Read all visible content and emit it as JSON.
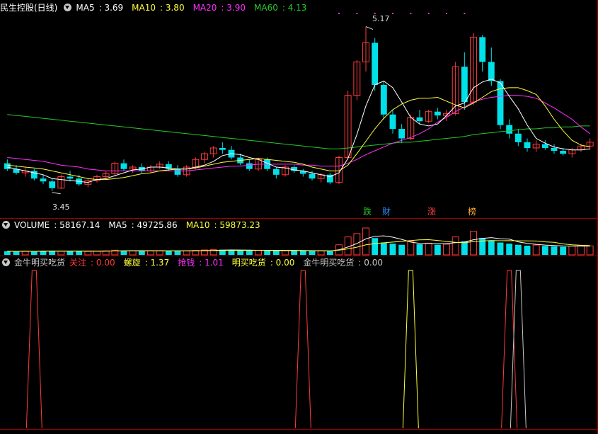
{
  "title": "民生控股(日线)",
  "colors": {
    "up": "#ff3b3b",
    "down": "#00e0e8",
    "ma5": "#ffffff",
    "ma10": "#ffff3c",
    "ma20": "#ff30ff",
    "ma60": "#27c927",
    "border": "#a00000"
  },
  "price_panel": {
    "labels": [
      {
        "name": "MA5",
        "value": "3.69",
        "color": "#ffffff"
      },
      {
        "name": "MA10",
        "value": "3.80",
        "color": "#ffff3c"
      },
      {
        "name": "MA20",
        "value": "3.90",
        "color": "#ff30ff"
      },
      {
        "name": "MA60",
        "value": "4.13",
        "color": "#27c927"
      }
    ],
    "high_mark": "5.17",
    "low_mark": "3.45",
    "signals": [
      {
        "text": "跌",
        "color": "#27c927"
      },
      {
        "text": "财",
        "color": "#2a8cff"
      },
      {
        "text": "涨",
        "color": "#ff4040"
      },
      {
        "text": "榜",
        "color": "#ffaa33"
      }
    ]
  },
  "volume_panel": {
    "title": "VOLUME",
    "value": "58167.14",
    "labels": [
      {
        "name": "MA5",
        "value": "49725.86",
        "color": "#ffffff"
      },
      {
        "name": "MA10",
        "value": "59873.23",
        "color": "#ffff3c"
      }
    ]
  },
  "indicator_panel": {
    "title": "金牛明买吃货",
    "labels": [
      {
        "name": "关注",
        "value": "0.00",
        "color": "#ff3b3b"
      },
      {
        "name": "螺旋",
        "value": "1.37",
        "color": "#ffff3c"
      },
      {
        "name": "抢钱",
        "value": "1.01",
        "color": "#ff30ff"
      },
      {
        "name": "明买吃货",
        "value": "0.00",
        "color": "#ffff3c"
      },
      {
        "name": "金牛明买吃货",
        "value": "0.00",
        "color": "#c8c8c8"
      }
    ]
  },
  "chart_data": {
    "type": "candlestick",
    "price_range": [
      3.3,
      5.3
    ],
    "ohlc": [
      [
        3.74,
        3.78,
        3.66,
        3.68
      ],
      [
        3.68,
        3.72,
        3.62,
        3.64
      ],
      [
        3.64,
        3.7,
        3.6,
        3.66
      ],
      [
        3.66,
        3.68,
        3.56,
        3.58
      ],
      [
        3.58,
        3.62,
        3.52,
        3.55
      ],
      [
        3.55,
        3.58,
        3.45,
        3.48
      ],
      [
        3.48,
        3.62,
        3.47,
        3.6
      ],
      [
        3.6,
        3.66,
        3.55,
        3.58
      ],
      [
        3.58,
        3.62,
        3.5,
        3.52
      ],
      [
        3.52,
        3.58,
        3.49,
        3.56
      ],
      [
        3.56,
        3.62,
        3.54,
        3.6
      ],
      [
        3.6,
        3.66,
        3.57,
        3.63
      ],
      [
        3.63,
        3.76,
        3.6,
        3.74
      ],
      [
        3.74,
        3.78,
        3.66,
        3.68
      ],
      [
        3.68,
        3.72,
        3.64,
        3.7
      ],
      [
        3.7,
        3.74,
        3.64,
        3.66
      ],
      [
        3.66,
        3.72,
        3.64,
        3.7
      ],
      [
        3.7,
        3.76,
        3.68,
        3.73
      ],
      [
        3.73,
        3.76,
        3.66,
        3.68
      ],
      [
        3.68,
        3.72,
        3.6,
        3.62
      ],
      [
        3.62,
        3.72,
        3.6,
        3.7
      ],
      [
        3.7,
        3.8,
        3.68,
        3.78
      ],
      [
        3.78,
        3.86,
        3.74,
        3.84
      ],
      [
        3.84,
        3.92,
        3.8,
        3.9
      ],
      [
        3.9,
        3.96,
        3.84,
        3.88
      ],
      [
        3.88,
        3.92,
        3.78,
        3.8
      ],
      [
        3.8,
        3.84,
        3.72,
        3.74
      ],
      [
        3.74,
        3.78,
        3.66,
        3.68
      ],
      [
        3.68,
        3.8,
        3.66,
        3.78
      ],
      [
        3.78,
        3.8,
        3.66,
        3.68
      ],
      [
        3.68,
        3.7,
        3.58,
        3.62
      ],
      [
        3.62,
        3.72,
        3.6,
        3.7
      ],
      [
        3.7,
        3.72,
        3.64,
        3.66
      ],
      [
        3.66,
        3.68,
        3.6,
        3.63
      ],
      [
        3.63,
        3.66,
        3.56,
        3.58
      ],
      [
        3.58,
        3.64,
        3.54,
        3.62
      ],
      [
        3.62,
        3.64,
        3.52,
        3.54
      ],
      [
        3.54,
        3.82,
        3.52,
        3.8
      ],
      [
        3.8,
        4.5,
        3.78,
        4.45
      ],
      [
        4.45,
        4.82,
        4.4,
        4.8
      ],
      [
        4.8,
        5.17,
        4.7,
        5.0
      ],
      [
        5.0,
        5.05,
        4.5,
        4.56
      ],
      [
        4.56,
        4.6,
        4.2,
        4.25
      ],
      [
        4.25,
        4.3,
        4.05,
        4.1
      ],
      [
        4.1,
        4.15,
        3.95,
        4.0
      ],
      [
        4.0,
        4.25,
        3.98,
        4.22
      ],
      [
        4.22,
        4.3,
        4.15,
        4.18
      ],
      [
        4.18,
        4.3,
        4.16,
        4.28
      ],
      [
        4.28,
        4.32,
        4.2,
        4.24
      ],
      [
        4.24,
        4.3,
        4.18,
        4.26
      ],
      [
        4.26,
        4.8,
        4.24,
        4.75
      ],
      [
        4.75,
        4.9,
        4.3,
        4.38
      ],
      [
        4.38,
        5.1,
        4.35,
        5.06
      ],
      [
        5.06,
        5.08,
        4.7,
        4.8
      ],
      [
        4.8,
        4.95,
        4.55,
        4.6
      ],
      [
        4.6,
        4.62,
        4.1,
        4.14
      ],
      [
        4.14,
        4.2,
        4.0,
        4.05
      ],
      [
        4.05,
        4.1,
        3.92,
        3.96
      ],
      [
        3.96,
        4.0,
        3.86,
        3.9
      ],
      [
        3.9,
        3.98,
        3.86,
        3.94
      ],
      [
        3.94,
        3.98,
        3.88,
        3.9
      ],
      [
        3.9,
        3.94,
        3.84,
        3.87
      ],
      [
        3.87,
        3.9,
        3.82,
        3.84
      ],
      [
        3.84,
        3.9,
        3.8,
        3.88
      ],
      [
        3.88,
        3.94,
        3.86,
        3.92
      ],
      [
        3.92,
        4.0,
        3.88,
        3.96
      ]
    ],
    "volume": [
      3200,
      3100,
      3400,
      3000,
      3600,
      3800,
      3300,
      3200,
      3500,
      3100,
      3400,
      3600,
      4200,
      3800,
      3500,
      3400,
      3600,
      3800,
      3500,
      3300,
      3600,
      4000,
      4400,
      4800,
      4600,
      4200,
      3900,
      3700,
      4100,
      3800,
      3600,
      3900,
      3700,
      3500,
      3400,
      3600,
      3300,
      9000,
      16000,
      19000,
      24000,
      15000,
      11000,
      10000,
      9000,
      12000,
      9500,
      10500,
      9000,
      9500,
      16000,
      12000,
      21000,
      15000,
      13000,
      11000,
      10000,
      9000,
      8200,
      8800,
      8000,
      7600,
      7200,
      7800,
      8400,
      8000
    ],
    "ma5": [
      3.7,
      3.68,
      3.66,
      3.64,
      3.62,
      3.58,
      3.57,
      3.56,
      3.55,
      3.54,
      3.57,
      3.58,
      3.61,
      3.64,
      3.67,
      3.68,
      3.7,
      3.7,
      3.69,
      3.68,
      3.68,
      3.7,
      3.72,
      3.76,
      3.82,
      3.84,
      3.83,
      3.8,
      3.78,
      3.74,
      3.7,
      3.69,
      3.67,
      3.66,
      3.64,
      3.62,
      3.6,
      3.64,
      3.79,
      4.04,
      4.34,
      4.56,
      4.6,
      4.53,
      4.38,
      4.22,
      4.15,
      4.13,
      4.15,
      4.24,
      4.34,
      4.37,
      4.53,
      4.59,
      4.62,
      4.58,
      4.44,
      4.31,
      4.14,
      4.0,
      3.95,
      3.91,
      3.89,
      3.88,
      3.88,
      3.89
    ],
    "ma10": [
      3.72,
      3.71,
      3.7,
      3.69,
      3.68,
      3.66,
      3.64,
      3.62,
      3.6,
      3.58,
      3.57,
      3.57,
      3.58,
      3.59,
      3.61,
      3.63,
      3.64,
      3.66,
      3.67,
      3.68,
      3.68,
      3.69,
      3.71,
      3.73,
      3.75,
      3.76,
      3.77,
      3.78,
      3.79,
      3.78,
      3.77,
      3.76,
      3.75,
      3.73,
      3.7,
      3.68,
      3.66,
      3.66,
      3.72,
      3.84,
      3.97,
      4.1,
      4.21,
      4.3,
      4.36,
      4.4,
      4.42,
      4.42,
      4.43,
      4.39,
      4.35,
      4.32,
      4.37,
      4.43,
      4.49,
      4.52,
      4.53,
      4.53,
      4.5,
      4.46,
      4.34,
      4.2,
      4.08,
      3.98,
      3.93,
      3.91
    ],
    "ma20": [
      3.8,
      3.79,
      3.78,
      3.77,
      3.76,
      3.74,
      3.72,
      3.71,
      3.7,
      3.68,
      3.67,
      3.66,
      3.66,
      3.66,
      3.66,
      3.66,
      3.66,
      3.66,
      3.66,
      3.66,
      3.66,
      3.67,
      3.68,
      3.69,
      3.7,
      3.71,
      3.71,
      3.72,
      3.73,
      3.73,
      3.73,
      3.73,
      3.73,
      3.72,
      3.72,
      3.71,
      3.71,
      3.71,
      3.74,
      3.78,
      3.83,
      3.87,
      3.91,
      3.95,
      3.98,
      4.01,
      4.05,
      4.1,
      4.17,
      4.22,
      4.28,
      4.33,
      4.38,
      4.41,
      4.43,
      4.44,
      4.45,
      4.45,
      4.44,
      4.42,
      4.37,
      4.32,
      4.26,
      4.2,
      4.12,
      4.05
    ],
    "ma60": [
      4.25,
      4.24,
      4.23,
      4.22,
      4.21,
      4.2,
      4.19,
      4.18,
      4.17,
      4.16,
      4.15,
      4.14,
      4.13,
      4.12,
      4.11,
      4.1,
      4.09,
      4.08,
      4.07,
      4.06,
      4.05,
      4.04,
      4.03,
      4.02,
      4.01,
      4.0,
      3.99,
      3.98,
      3.97,
      3.96,
      3.95,
      3.94,
      3.93,
      3.92,
      3.91,
      3.9,
      3.89,
      3.89,
      3.9,
      3.91,
      3.92,
      3.93,
      3.94,
      3.95,
      3.96,
      3.96,
      3.97,
      3.98,
      3.99,
      4.0,
      4.01,
      4.02,
      4.04,
      4.05,
      4.06,
      4.07,
      4.08,
      4.09,
      4.1,
      4.1,
      4.11,
      4.11,
      4.12,
      4.12,
      4.13,
      4.13
    ],
    "indicator_spikes": [
      {
        "index": 3,
        "color": "#ff3b3b"
      },
      {
        "index": 33,
        "color": "#ff3b3b"
      },
      {
        "index": 45,
        "color": "#ffff3c"
      },
      {
        "index": 56,
        "color": "#ff3b3b"
      },
      {
        "index": 57,
        "color": "#c8c8c8"
      }
    ]
  }
}
